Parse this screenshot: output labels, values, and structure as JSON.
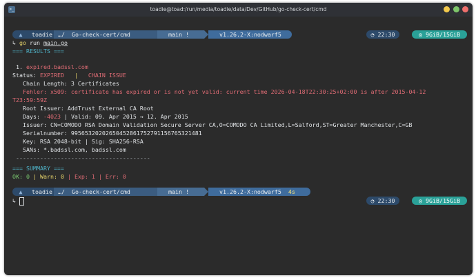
{
  "window": {
    "title": "toadie@toad:/run/media/toadie/data/Dev/GitHub/go-check-cert/cmd",
    "icon": "terminal-icon"
  },
  "prompt1": {
    "os_icon": "arch-icon",
    "os_glyph": "▲",
    "user": "toadie",
    "dir": "…/  Go-check-cert/cmd",
    "git": "  main !",
    "go_version": "  v1.26.2-X:nodwarf5",
    "time": "◔ 22:30",
    "memory": "◎ 9GiB/15GiB"
  },
  "command": {
    "arrow": "↳",
    "cmd": "go",
    "args_prefix": " run ",
    "file": "main.go"
  },
  "results_header": "=== RESULTS ===",
  "result": {
    "index": " 1. ",
    "host": "expired.badssl.com",
    "status_label": "Status: ",
    "status_value": "EXPIRED",
    "status_sep": "   | ",
    "issue": "  CHAIN ISSUE",
    "chain_length": "   Chain Length: 3 Certificates",
    "error_line1": "   Fehler: x509: certificate has expired or is not yet valid: current time 2026-04-18T22:30:25+02:00 is after 2015-04-12",
    "error_line2": "T23:59:59Z",
    "root_issuer": "   Root Issuer: AddTrust External CA Root",
    "days_label": "   Days: ",
    "days_value": "-4023",
    "validity": " | Valid: 09. Apr 2015 → 12. Apr 2015",
    "issuer": "   Issuer: CN=COMODO RSA Domain Validation Secure Server CA,O=COMODO CA Limited,L=Salford,ST=Greater Manchester,C=GB",
    "serial": "   Serialnumber: 99565320202650452861752791156765321481",
    "key": "   Key: RSA 2048-bit | Sig: SHA256-RSA",
    "sans": "   SANs: *.badssl.com, badssl.com",
    "divider": " ---------------------------------------"
  },
  "summary": {
    "header": "=== SUMMARY ===",
    "ok_label": "OK: ",
    "ok": "0",
    "warn_label": " | Warn: ",
    "warn": "0",
    "exp_label": " | Exp: ",
    "exp": "1",
    "err_label": " | Err: ",
    "err": "0"
  },
  "prompt2": {
    "os_glyph": "▲",
    "user": "toadie",
    "dir": "…/  Go-check-cert/cmd",
    "git": "  main !",
    "go_version": "  v1.26.2-X:nodwarf5",
    "duration": "4s",
    "time": "◔ 22:30",
    "memory": "◎ 9GiB/15GiB",
    "arrow": "↳"
  },
  "colors": {
    "background": "#2b2b2b",
    "accent_cyan": "#4fb3c8",
    "error_red": "#e06c75",
    "ok_green": "#7bc96f",
    "warn_yellow": "#e6d36a",
    "memory_teal": "#2aa198"
  }
}
